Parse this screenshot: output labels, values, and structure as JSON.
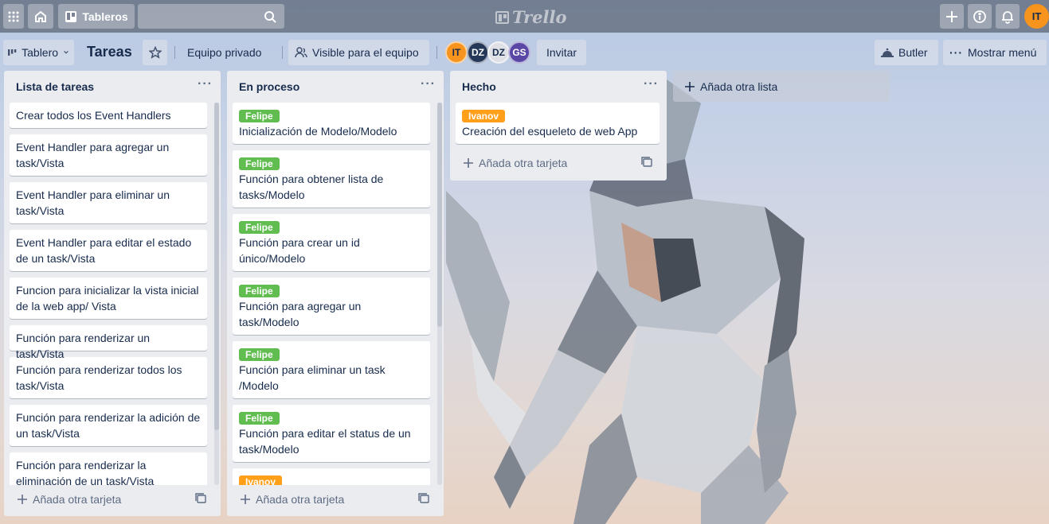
{
  "header": {
    "boards_label": "Tableros",
    "logo_text": "Trello",
    "user_initials": "IT",
    "icons": [
      "apps-icon",
      "home-icon",
      "boards-icon",
      "search-icon",
      "plus-icon",
      "info-icon",
      "bell-icon"
    ]
  },
  "board": {
    "switch_label": "Tablero",
    "title": "Tareas",
    "team_label": "Equipo privado",
    "visibility_label": "Visible para el equipo",
    "members": [
      "IT",
      "DZ",
      "DZ",
      "GS"
    ],
    "invite_label": "Invitar",
    "butler_label": "Butler",
    "menu_label": "Mostrar menú"
  },
  "lists": [
    {
      "title": "Lista de tareas",
      "menu": "···",
      "cards": [
        {
          "text": "Crear todos los Event Handlers"
        },
        {
          "text": "Event Handler para agregar un task/Vista"
        },
        {
          "text": "Event Handler para eliminar un task/Vista"
        },
        {
          "text": "Event Handler para editar el estado de un task/Vista"
        },
        {
          "text": "Funcion para inicializar la vista inicial de la web app/ Vista"
        },
        {
          "text": "Función para renderizar un task/Vista"
        },
        {
          "text": "Función para renderizar todos los task/Vista"
        },
        {
          "text": "Función para renderizar la adición de un task/Vista"
        },
        {
          "text": "Función para renderizar la eliminación de un task/Vista"
        }
      ],
      "add_label": "Añada otra tarjeta"
    },
    {
      "title": "En proceso",
      "menu": "···",
      "cards": [
        {
          "label": "Felipe",
          "label_color": "#61bd4f",
          "text": "Inicialización de Modelo/Modelo"
        },
        {
          "label": "Felipe",
          "label_color": "#61bd4f",
          "text": "Función para obtener lista de tasks/Modelo"
        },
        {
          "label": "Felipe",
          "label_color": "#61bd4f",
          "text": "Función para crear un id único/Modelo"
        },
        {
          "label": "Felipe",
          "label_color": "#61bd4f",
          "text": "Función para agregar un task/Modelo"
        },
        {
          "label": "Felipe",
          "label_color": "#61bd4f",
          "text": "Función para eliminar un task /Modelo"
        },
        {
          "label": "Felipe",
          "label_color": "#61bd4f",
          "text": "Función para editar el status de un task/Modelo"
        },
        {
          "label": "Ivanov",
          "label_color": "#ff9f1a",
          "text": ""
        }
      ],
      "add_label": "Añada otra tarjeta"
    },
    {
      "title": "Hecho",
      "menu": "···",
      "cards": [
        {
          "label": "Ivanov",
          "label_color": "#ff9f1a",
          "text": "Creación del esqueleto de web App"
        }
      ],
      "add_label": "Añada otra tarjeta"
    }
  ],
  "add_list_label": "Añada otra lista"
}
